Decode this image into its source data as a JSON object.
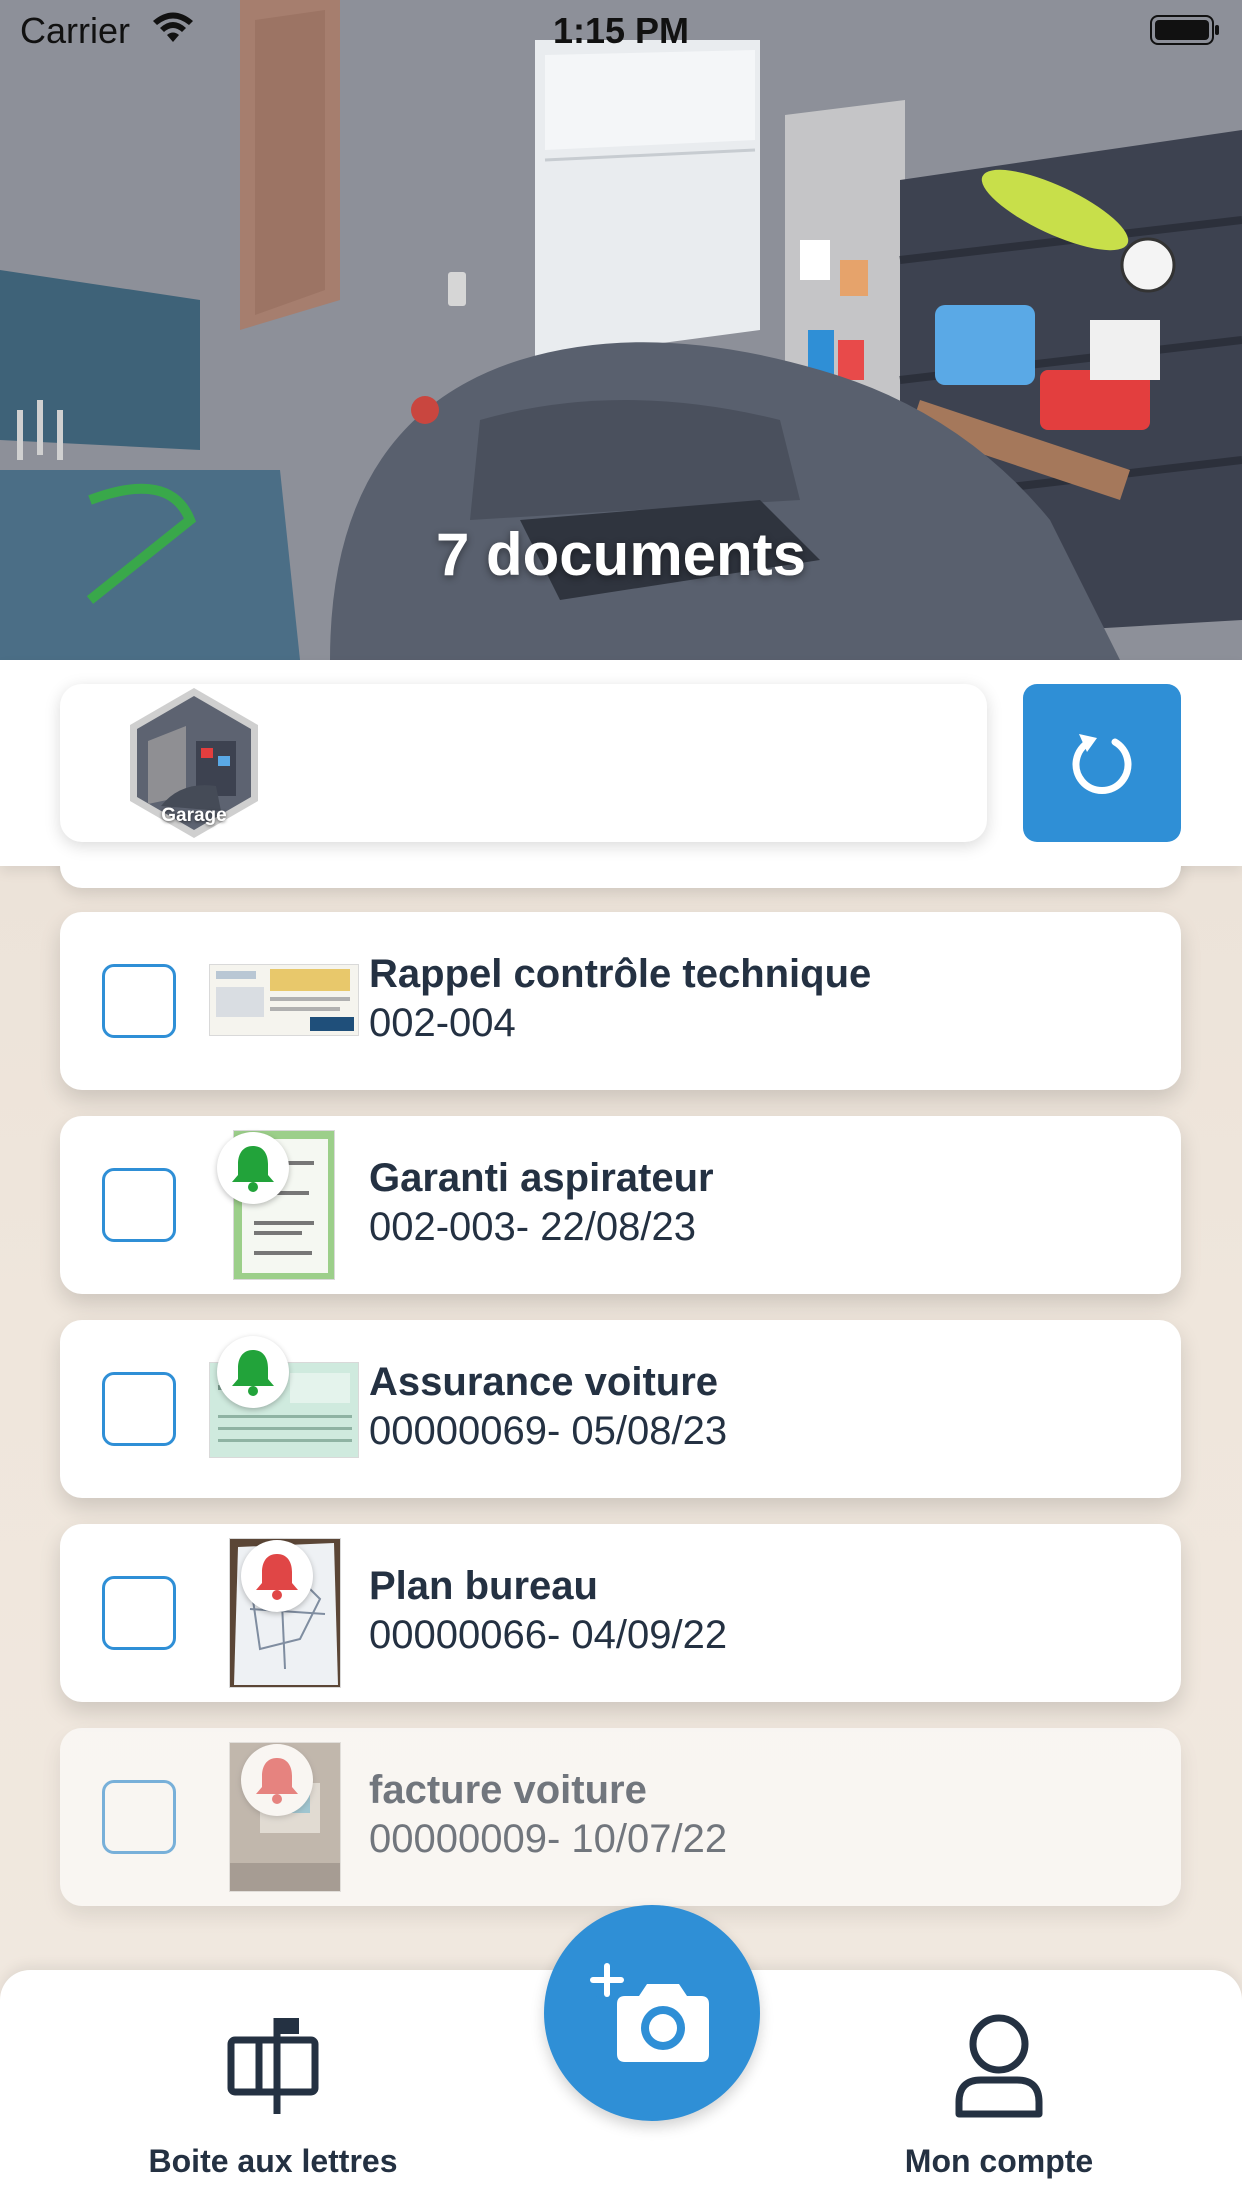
{
  "status_bar": {
    "carrier": "Carrier",
    "time": "1:15 PM"
  },
  "hero": {
    "count_text": "7 documents"
  },
  "filter": {
    "room_label": "Garage"
  },
  "documents": [
    {
      "title": "Rappel contrôle technique",
      "reference": "002-004",
      "date": "",
      "alert": "none"
    },
    {
      "title": "Garanti aspirateur",
      "reference": "002-003",
      "date": "- 22/08/23",
      "alert": "green"
    },
    {
      "title": "Assurance voiture",
      "reference": "00000069",
      "date": "- 05/08/23",
      "alert": "green"
    },
    {
      "title": "Plan bureau",
      "reference": "00000066",
      "date": "- 04/09/22",
      "alert": "red"
    },
    {
      "title": "facture voiture",
      "reference": "00000009",
      "date": "- 10/07/22",
      "alert": "red"
    }
  ],
  "bottom_nav": {
    "mailbox_label": "Boite aux lettres",
    "account_label": "Mon compte"
  },
  "colors": {
    "accent": "#2f8fd6",
    "alert_green": "#22a33a",
    "alert_red": "#e04646",
    "text": "#243142"
  }
}
